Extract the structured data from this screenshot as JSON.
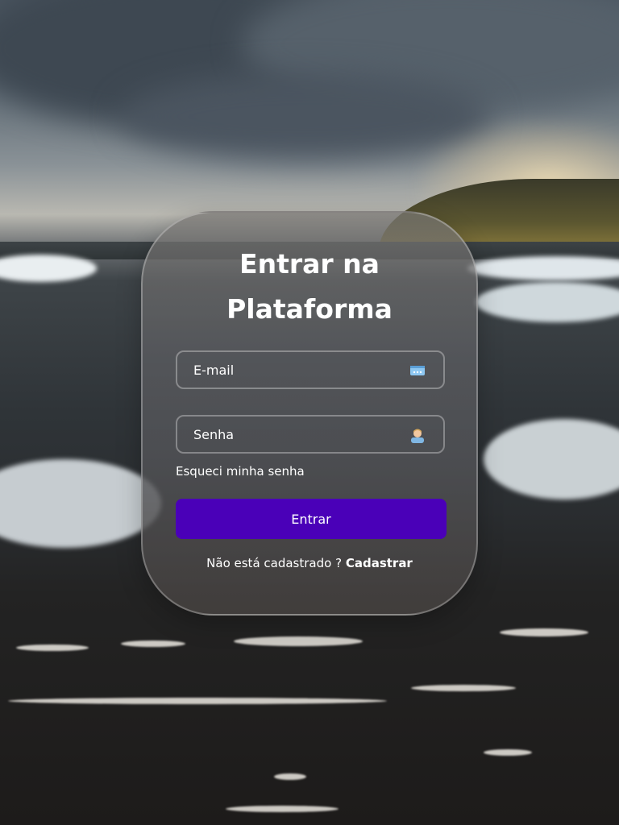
{
  "login": {
    "title_line1": "Entrar na",
    "title_line2": "Plataforma",
    "email": {
      "placeholder": "E-mail",
      "value": "",
      "icon": "card-icon"
    },
    "password": {
      "placeholder": "Senha",
      "value": "",
      "icon": "user-icon"
    },
    "forgot_link": "Esqueci minha senha",
    "submit_label": "Entrar",
    "signup_prompt": "Não está cadastrado ?",
    "signup_link": "Cadastrar"
  },
  "colors": {
    "button": "#4a00b8",
    "text": "#ffffff",
    "card_border": "rgba(255,255,255,0.28)"
  }
}
